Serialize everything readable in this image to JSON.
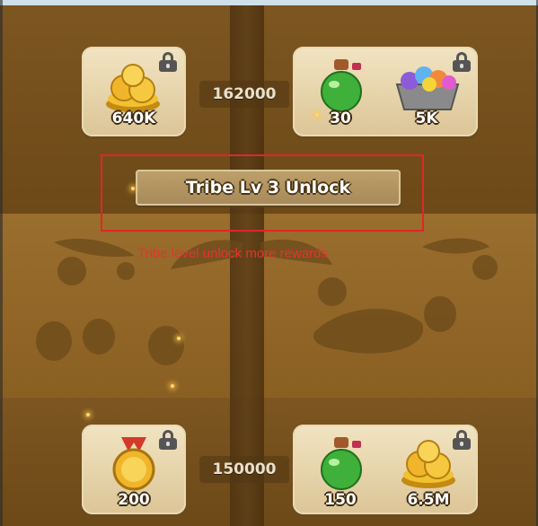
{
  "rewards_top": {
    "score": "162000",
    "card_left": {
      "coins_qty": "640K"
    },
    "card_right": {
      "potion_qty": "30",
      "gems_qty": "5K"
    }
  },
  "unlock": {
    "button_label": "Tribe Lv 3 Unlock",
    "annotation": "Tribe level unlock more rewards"
  },
  "rewards_bottom": {
    "score": "150000",
    "card_left": {
      "medal_qty": "200"
    },
    "card_right": {
      "potion_qty": "150",
      "coins_qty": "6.5M"
    }
  },
  "colors": {
    "highlight_border": "#e0262a",
    "annotation_text": "#e8322e"
  }
}
